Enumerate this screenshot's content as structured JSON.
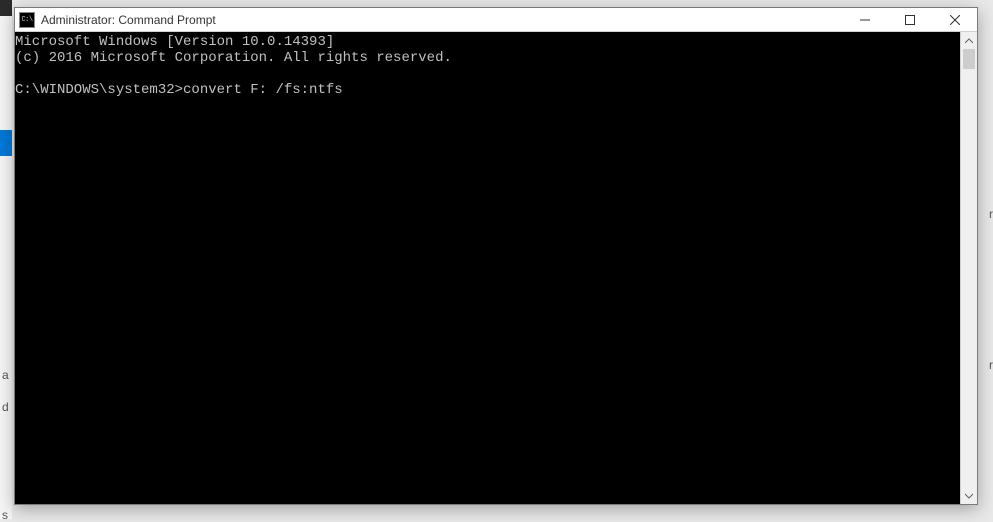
{
  "window": {
    "title": "Administrator: Command Prompt",
    "icon_text": "C:\\"
  },
  "console": {
    "line1": "Microsoft Windows [Version 10.0.14393]",
    "line2": "(c) 2016 Microsoft Corporation. All rights reserved.",
    "blank": "",
    "prompt": "C:\\WINDOWS\\system32>",
    "command": "convert F: /fs:ntfs"
  },
  "bg": {
    "frag1": "r",
    "frag2": "d",
    "frag3": "r",
    "frag4": "a",
    "frag5": "s"
  }
}
